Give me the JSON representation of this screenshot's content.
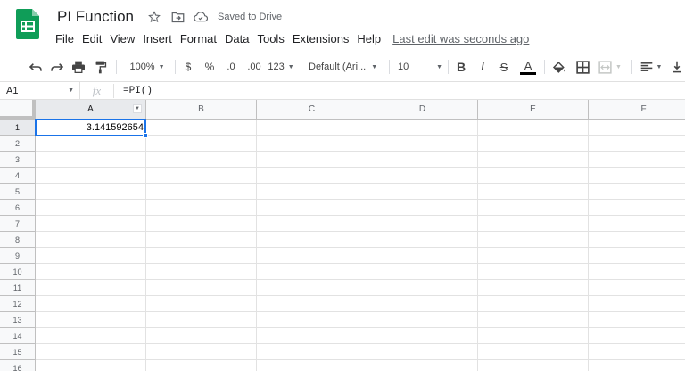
{
  "document": {
    "title": "PI Function",
    "save_status": "Saved to Drive"
  },
  "menu": {
    "items": [
      "File",
      "Edit",
      "View",
      "Insert",
      "Format",
      "Data",
      "Tools",
      "Extensions",
      "Help"
    ],
    "last_edit": "Last edit was seconds ago"
  },
  "toolbar": {
    "zoom": "100%",
    "currency": "$",
    "percent": "%",
    "decrease_decimal": ".0",
    "increase_decimal": ".00",
    "more_formats": "123",
    "font": "Default (Ari...",
    "font_size": "10",
    "bold": "B",
    "italic": "I",
    "strike": "S",
    "text_color_letter": "A",
    "text_color": "#000000"
  },
  "formula_bar": {
    "name_box": "A1",
    "fx_label": "fx",
    "formula": "=PI()"
  },
  "grid": {
    "columns": [
      "A",
      "B",
      "C",
      "D",
      "E",
      "F"
    ],
    "rows": [
      "1",
      "2",
      "3",
      "4",
      "5",
      "6",
      "7",
      "8",
      "9",
      "10",
      "11",
      "12",
      "13",
      "14",
      "15",
      "16"
    ],
    "selected_cell": "A1",
    "cell_a1_value": "3.141592654"
  },
  "colors": {
    "sheets_green": "#0f9d58",
    "selection_blue": "#1a73e8"
  }
}
